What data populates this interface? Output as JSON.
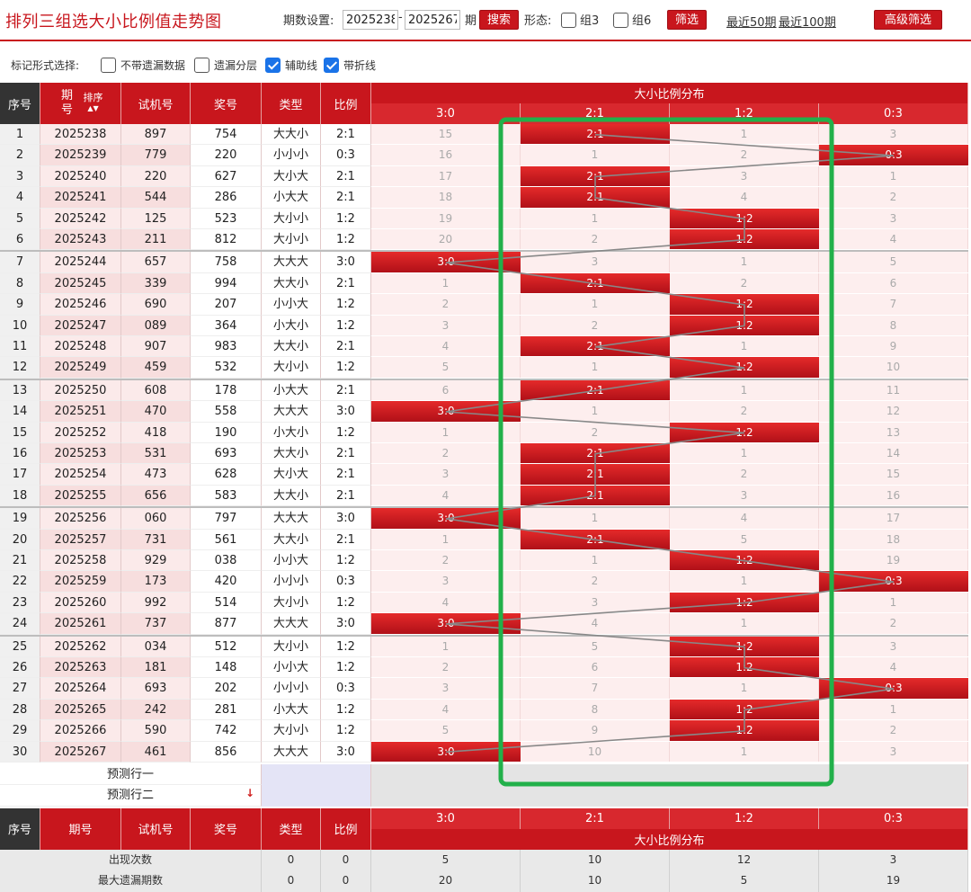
{
  "page": {
    "title": "排列三组选大小比例值走势图",
    "period_label": "期数设置:",
    "period_from": "2025238",
    "period_dash": "-",
    "period_to": "2025267",
    "period_suffix": "期",
    "search_label": "搜索",
    "form_label": "形态:",
    "form_opt1": "组3",
    "form_opt2": "组6",
    "filter_label": "筛选",
    "recent50": "最近50期",
    "recent100": "最近100期",
    "advanced_filter": "高级筛选"
  },
  "mark_options": {
    "label": "标记形式选择:",
    "opt_no_miss": "不带遗漏数据",
    "opt_layer": "遗漏分层",
    "opt_aux": "辅助线",
    "opt_line": "带折线"
  },
  "table": {
    "headers": {
      "seq": "序号",
      "period": "期号",
      "sort": "排序",
      "trial": "试机号",
      "award": "奖号",
      "type": "类型",
      "ratio": "比例",
      "dist": "大小比例分布"
    },
    "dist_cols": [
      "3:0",
      "2:1",
      "1:2",
      "0:3"
    ],
    "rows": [
      {
        "seq": "1",
        "period": "2025238",
        "trial": "897",
        "award": "754",
        "type": "大大小",
        "ratio": "2:1",
        "hit": 1,
        "cells": [
          "15",
          "2:1",
          "1",
          "3"
        ]
      },
      {
        "seq": "2",
        "period": "2025239",
        "trial": "779",
        "award": "220",
        "type": "小小小",
        "ratio": "0:3",
        "hit": 3,
        "cells": [
          "16",
          "1",
          "2",
          "0:3"
        ]
      },
      {
        "seq": "3",
        "period": "2025240",
        "trial": "220",
        "award": "627",
        "type": "大小大",
        "ratio": "2:1",
        "hit": 1,
        "cells": [
          "17",
          "2:1",
          "3",
          "1"
        ]
      },
      {
        "seq": "4",
        "period": "2025241",
        "trial": "544",
        "award": "286",
        "type": "小大大",
        "ratio": "2:1",
        "hit": 1,
        "cells": [
          "18",
          "2:1",
          "4",
          "2"
        ]
      },
      {
        "seq": "5",
        "period": "2025242",
        "trial": "125",
        "award": "523",
        "type": "大小小",
        "ratio": "1:2",
        "hit": 2,
        "cells": [
          "19",
          "1",
          "1:2",
          "3"
        ]
      },
      {
        "seq": "6",
        "period": "2025243",
        "trial": "211",
        "award": "812",
        "type": "大小小",
        "ratio": "1:2",
        "hit": 2,
        "cells": [
          "20",
          "2",
          "1:2",
          "4"
        ]
      },
      {
        "seq": "7",
        "period": "2025244",
        "trial": "657",
        "award": "758",
        "type": "大大大",
        "ratio": "3:0",
        "hit": 0,
        "cells": [
          "3:0",
          "3",
          "1",
          "5"
        ]
      },
      {
        "seq": "8",
        "period": "2025245",
        "trial": "339",
        "award": "994",
        "type": "大大小",
        "ratio": "2:1",
        "hit": 1,
        "cells": [
          "1",
          "2:1",
          "2",
          "6"
        ]
      },
      {
        "seq": "9",
        "period": "2025246",
        "trial": "690",
        "award": "207",
        "type": "小小大",
        "ratio": "1:2",
        "hit": 2,
        "cells": [
          "2",
          "1",
          "1:2",
          "7"
        ]
      },
      {
        "seq": "10",
        "period": "2025247",
        "trial": "089",
        "award": "364",
        "type": "小大小",
        "ratio": "1:2",
        "hit": 2,
        "cells": [
          "3",
          "2",
          "1:2",
          "8"
        ]
      },
      {
        "seq": "11",
        "period": "2025248",
        "trial": "907",
        "award": "983",
        "type": "大大小",
        "ratio": "2:1",
        "hit": 1,
        "cells": [
          "4",
          "2:1",
          "1",
          "9"
        ]
      },
      {
        "seq": "12",
        "period": "2025249",
        "trial": "459",
        "award": "532",
        "type": "大小小",
        "ratio": "1:2",
        "hit": 2,
        "cells": [
          "5",
          "1",
          "1:2",
          "10"
        ]
      },
      {
        "seq": "13",
        "period": "2025250",
        "trial": "608",
        "award": "178",
        "type": "小大大",
        "ratio": "2:1",
        "hit": 1,
        "cells": [
          "6",
          "2:1",
          "1",
          "11"
        ]
      },
      {
        "seq": "14",
        "period": "2025251",
        "trial": "470",
        "award": "558",
        "type": "大大大",
        "ratio": "3:0",
        "hit": 0,
        "cells": [
          "3:0",
          "1",
          "2",
          "12"
        ]
      },
      {
        "seq": "15",
        "period": "2025252",
        "trial": "418",
        "award": "190",
        "type": "小大小",
        "ratio": "1:2",
        "hit": 2,
        "cells": [
          "1",
          "2",
          "1:2",
          "13"
        ]
      },
      {
        "seq": "16",
        "period": "2025253",
        "trial": "531",
        "award": "693",
        "type": "大大小",
        "ratio": "2:1",
        "hit": 1,
        "cells": [
          "2",
          "2:1",
          "1",
          "14"
        ]
      },
      {
        "seq": "17",
        "period": "2025254",
        "trial": "473",
        "award": "628",
        "type": "大小大",
        "ratio": "2:1",
        "hit": 1,
        "cells": [
          "3",
          "2:1",
          "2",
          "15"
        ]
      },
      {
        "seq": "18",
        "period": "2025255",
        "trial": "656",
        "award": "583",
        "type": "大大小",
        "ratio": "2:1",
        "hit": 1,
        "cells": [
          "4",
          "2:1",
          "3",
          "16"
        ]
      },
      {
        "seq": "19",
        "period": "2025256",
        "trial": "060",
        "award": "797",
        "type": "大大大",
        "ratio": "3:0",
        "hit": 0,
        "cells": [
          "3:0",
          "1",
          "4",
          "17"
        ]
      },
      {
        "seq": "20",
        "period": "2025257",
        "trial": "731",
        "award": "561",
        "type": "大大小",
        "ratio": "2:1",
        "hit": 1,
        "cells": [
          "1",
          "2:1",
          "5",
          "18"
        ]
      },
      {
        "seq": "21",
        "period": "2025258",
        "trial": "929",
        "award": "038",
        "type": "小小大",
        "ratio": "1:2",
        "hit": 2,
        "cells": [
          "2",
          "1",
          "1:2",
          "19"
        ]
      },
      {
        "seq": "22",
        "period": "2025259",
        "trial": "173",
        "award": "420",
        "type": "小小小",
        "ratio": "0:3",
        "hit": 3,
        "cells": [
          "3",
          "2",
          "1",
          "0:3"
        ]
      },
      {
        "seq": "23",
        "period": "2025260",
        "trial": "992",
        "award": "514",
        "type": "大小小",
        "ratio": "1:2",
        "hit": 2,
        "cells": [
          "4",
          "3",
          "1:2",
          "1"
        ]
      },
      {
        "seq": "24",
        "period": "2025261",
        "trial": "737",
        "award": "877",
        "type": "大大大",
        "ratio": "3:0",
        "hit": 0,
        "cells": [
          "3:0",
          "4",
          "1",
          "2"
        ]
      },
      {
        "seq": "25",
        "period": "2025262",
        "trial": "034",
        "award": "512",
        "type": "大小小",
        "ratio": "1:2",
        "hit": 2,
        "cells": [
          "1",
          "5",
          "1:2",
          "3"
        ]
      },
      {
        "seq": "26",
        "period": "2025263",
        "trial": "181",
        "award": "148",
        "type": "小小大",
        "ratio": "1:2",
        "hit": 2,
        "cells": [
          "2",
          "6",
          "1:2",
          "4"
        ]
      },
      {
        "seq": "27",
        "period": "2025264",
        "trial": "693",
        "award": "202",
        "type": "小小小",
        "ratio": "0:3",
        "hit": 3,
        "cells": [
          "3",
          "7",
          "1",
          "0:3"
        ]
      },
      {
        "seq": "28",
        "period": "2025265",
        "trial": "242",
        "award": "281",
        "type": "小大大",
        "ratio": "1:2",
        "hit": 2,
        "cells": [
          "4",
          "8",
          "1:2",
          "1"
        ]
      },
      {
        "seq": "29",
        "period": "2025266",
        "trial": "590",
        "award": "742",
        "type": "大小小",
        "ratio": "1:2",
        "hit": 2,
        "cells": [
          "5",
          "9",
          "1:2",
          "2"
        ]
      },
      {
        "seq": "30",
        "period": "2025267",
        "trial": "461",
        "award": "856",
        "type": "大大大",
        "ratio": "3:0",
        "hit": 0,
        "cells": [
          "3:0",
          "10",
          "1",
          "3"
        ]
      }
    ],
    "predict1": "预测行一",
    "predict2": "预测行二",
    "stats": [
      {
        "label": "出现次数",
        "type": "0",
        "ratio": "0",
        "cells": [
          "5",
          "10",
          "12",
          "3"
        ]
      },
      {
        "label": "最大遗漏期数",
        "type": "0",
        "ratio": "0",
        "cells": [
          "20",
          "10",
          "5",
          "19"
        ]
      }
    ]
  },
  "colors": {
    "brand": "#c8161d",
    "highlight_box": "#22b04a",
    "trend_line": "#888888"
  }
}
